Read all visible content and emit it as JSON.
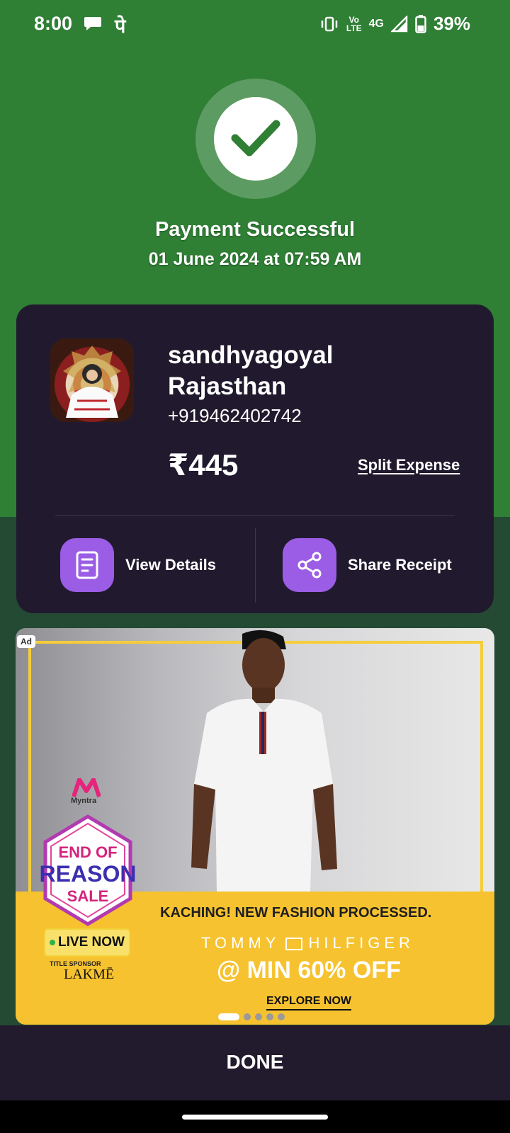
{
  "status_bar": {
    "time": "8:00",
    "indicator": "पे",
    "volte_top": "Vo",
    "volte_bottom": "LTE",
    "network": "4G",
    "battery": "39%"
  },
  "success": {
    "title": "Payment Successful",
    "datetime": "01 June 2024 at 07:59 AM"
  },
  "payment_card": {
    "name_line1": "sandhyagoyal",
    "name_line2": "Rajasthan",
    "phone": "+919462402742",
    "amount": "₹445",
    "split_label": "Split Expense",
    "view_details_label": "View Details",
    "share_receipt_label": "Share Receipt"
  },
  "ad": {
    "tag": "Ad",
    "brand": "Myntra",
    "live_label": "LIVE NOW",
    "sponsor_label": "TITLE SPONSOR",
    "sponsor_name": "LAKMĒ",
    "headline": "KACHING! NEW FASHION PROCESSED.",
    "tommy_left": "TOMMY",
    "tommy_right": "HILFIGER",
    "offer": "@ MIN 60% OFF",
    "cta": "EXPLORE NOW",
    "sale_line1": "END OF",
    "sale_line2": "REASON",
    "sale_line3": "SALE"
  },
  "done_label": "DONE",
  "colors": {
    "success_green": "#2f7f35",
    "card_bg": "#211a2e",
    "action_purple": "#9b5de5",
    "ad_yellow": "#f6c22f"
  }
}
